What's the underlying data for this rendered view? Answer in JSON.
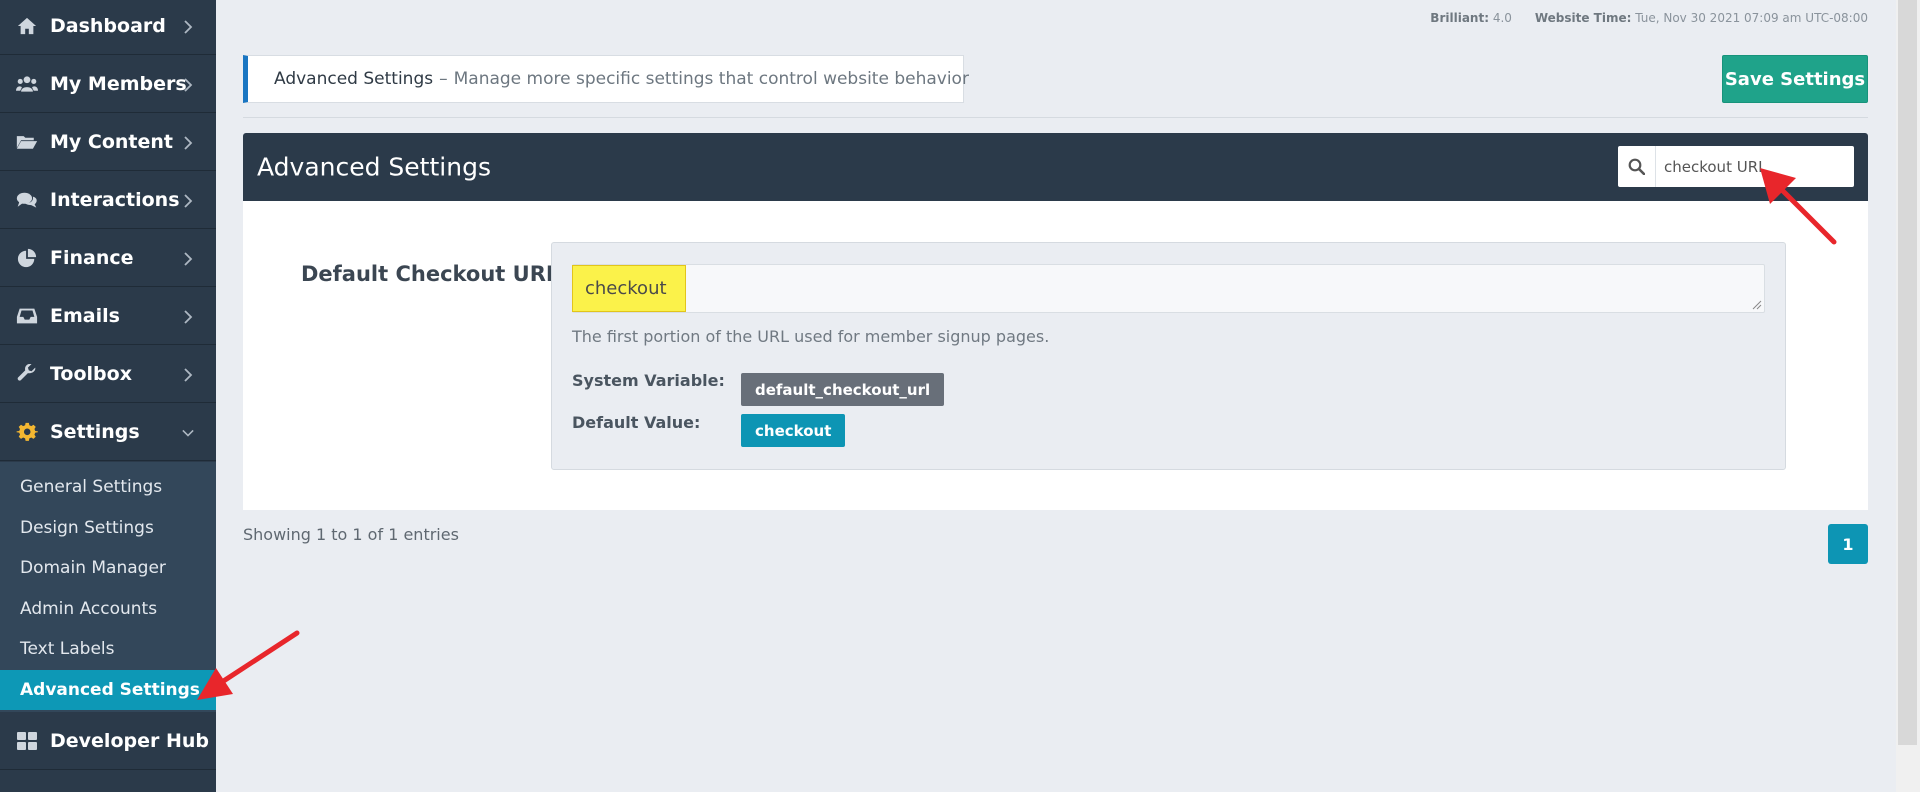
{
  "sidebar": {
    "items": [
      {
        "label": "Dashboard",
        "icon": "home-icon"
      },
      {
        "label": "My Members",
        "icon": "users-icon"
      },
      {
        "label": "My Content",
        "icon": "folder-open-icon"
      },
      {
        "label": "Interactions",
        "icon": "comments-icon"
      },
      {
        "label": "Finance",
        "icon": "pie-chart-icon"
      },
      {
        "label": "Emails",
        "icon": "inbox-icon"
      },
      {
        "label": "Toolbox",
        "icon": "wrench-icon"
      },
      {
        "label": "Settings",
        "icon": "gear-icon"
      },
      {
        "label": "Developer Hub",
        "icon": "grid-icon"
      }
    ],
    "settings_submenu": [
      "General Settings",
      "Design Settings",
      "Domain Manager",
      "Admin Accounts",
      "Text Labels",
      "Advanced Settings"
    ],
    "active_submenu_item": "Advanced Settings"
  },
  "topbar": {
    "version_label": "Brilliant:",
    "version_value": "4.0",
    "time_label": "Website Time:",
    "time_value": "Tue, Nov 30 2021 07:09 am UTC-08:00"
  },
  "banner": {
    "title": "Advanced Settings",
    "separator": "–",
    "description": "Manage more specific settings that control website behavior"
  },
  "save_button_label": "Save Settings",
  "panel": {
    "title": "Advanced Settings",
    "search_value": "checkout URL"
  },
  "setting": {
    "label": "Default Checkout URL",
    "value": "checkout",
    "help_text": "The first portion of the URL used for member signup pages.",
    "system_variable_label": "System Variable:",
    "system_variable_value": "default_checkout_url",
    "default_value_label": "Default Value:",
    "default_value": "checkout"
  },
  "pagination": {
    "entries_info": "Showing 1 to 1 of 1 entries",
    "current_page": "1"
  },
  "colors": {
    "sidebar_bg": "#2b3a4a",
    "submenu_bg": "#33475a",
    "active_accent": "#0d98b6",
    "save_button": "#1fa38a",
    "highlight": "#fbf24a",
    "annotation_arrow": "#e8262b"
  }
}
